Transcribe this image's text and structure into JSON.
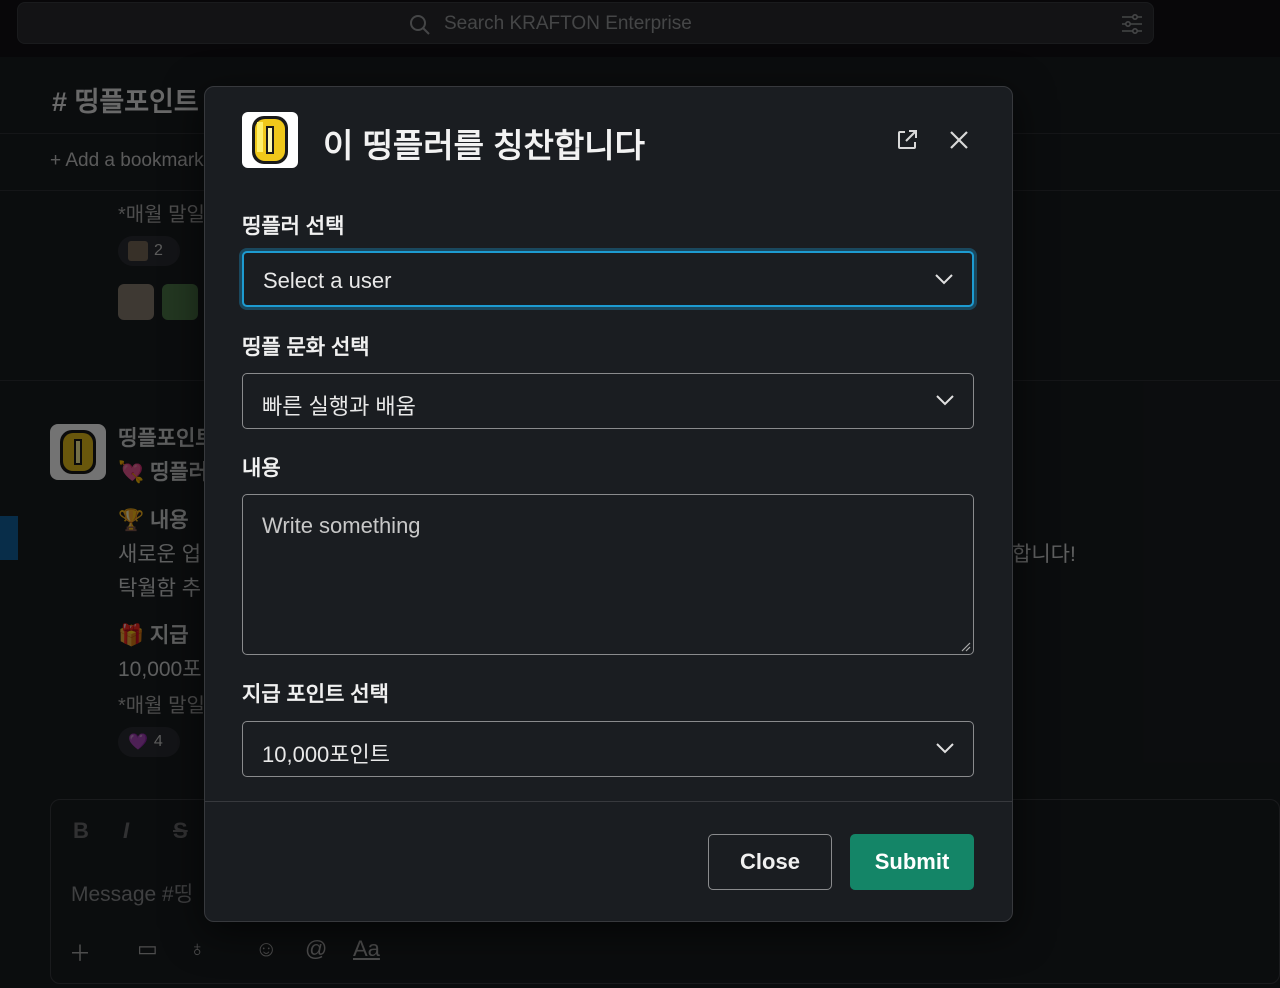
{
  "search": {
    "placeholder": "Search KRAFTON Enterprise"
  },
  "background": {
    "channel_title": "# 띵플포인트",
    "bookmark": "+  Add a bookmark",
    "lines": [
      "*매월 말일",
      "띵플포인트",
      "💘 띵플러",
      "🏆 내용",
      "새로운 업",
      "탁월함 추",
      "🎁 지급",
      "10,000포",
      "*매월 말일",
      "합니다!"
    ],
    "reaction_counts": [
      "2",
      "4"
    ],
    "composer_placeholder": "Message #띵"
  },
  "modal": {
    "title": "이 띵플러를 칭찬합니다",
    "fields": [
      {
        "label": "띵플러 선택",
        "value": "Select a user",
        "focused": true
      },
      {
        "label": "띵플 문화 선택",
        "value": "빠른 실행과 배움"
      },
      {
        "label": "내용",
        "placeholder": "Write something"
      },
      {
        "label": "지급 포인트 선택",
        "value": "10,000포인트"
      }
    ],
    "close_label": "Close",
    "submit_label": "Submit"
  },
  "colors": {
    "accent": "#1d9bd1",
    "submit": "#148567",
    "modal_bg": "#1a1d21"
  }
}
